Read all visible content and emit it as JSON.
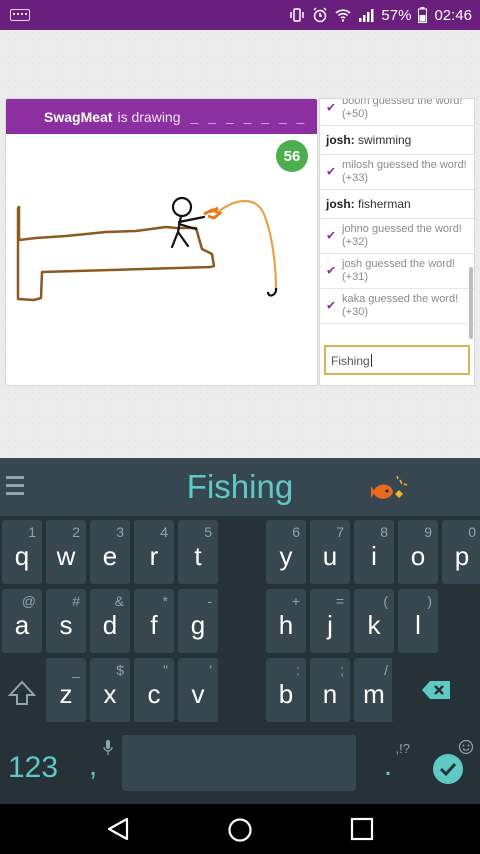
{
  "status_bar": {
    "battery": "57%",
    "time": "02:46"
  },
  "game": {
    "drawer_name": "SwagMeat",
    "drawing_text": "is drawing",
    "word_blanks": "_ _ _ _ _ _ _",
    "timer": "56"
  },
  "chat": {
    "messages": [
      {
        "type": "sys",
        "text": "boom guessed the word!",
        "points": "(+50)"
      },
      {
        "type": "chat",
        "user": "josh:",
        "text": "swimming"
      },
      {
        "type": "sys",
        "text": "milosh guessed the word!",
        "points": "(+33)"
      },
      {
        "type": "chat",
        "user": "josh:",
        "text": "fisherman"
      },
      {
        "type": "sys",
        "text": "johno guessed the word!",
        "points": "(+32)"
      },
      {
        "type": "sys",
        "text": "josh guessed the word!",
        "points": "(+31)"
      },
      {
        "type": "sys",
        "text": "kaka guessed the word!",
        "points": "(+30)"
      }
    ],
    "input_value": "Fishing"
  },
  "keyboard": {
    "suggestion": "Fishing",
    "row1": [
      {
        "ch": "q",
        "hint": "1"
      },
      {
        "ch": "w",
        "hint": "2"
      },
      {
        "ch": "e",
        "hint": "3"
      },
      {
        "ch": "r",
        "hint": "4"
      },
      {
        "ch": "t",
        "hint": "5"
      },
      {
        "ch": "y",
        "hint": "6"
      },
      {
        "ch": "u",
        "hint": "7"
      },
      {
        "ch": "i",
        "hint": "8"
      },
      {
        "ch": "o",
        "hint": "9"
      },
      {
        "ch": "p",
        "hint": "0"
      }
    ],
    "row2": [
      {
        "ch": "a",
        "hint": "@"
      },
      {
        "ch": "s",
        "hint": "#"
      },
      {
        "ch": "d",
        "hint": "&"
      },
      {
        "ch": "f",
        "hint": "*"
      },
      {
        "ch": "g",
        "hint": "-"
      },
      {
        "ch": "h",
        "hint": "+"
      },
      {
        "ch": "j",
        "hint": "="
      },
      {
        "ch": "k",
        "hint": "("
      },
      {
        "ch": "l",
        "hint": ")"
      }
    ],
    "row3": [
      {
        "ch": "z",
        "hint": "_"
      },
      {
        "ch": "x",
        "hint": "$"
      },
      {
        "ch": "c",
        "hint": "\""
      },
      {
        "ch": "v",
        "hint": "'"
      },
      {
        "ch": "b",
        "hint": ":"
      },
      {
        "ch": "n",
        "hint": ";"
      },
      {
        "ch": "m",
        "hint": "/"
      }
    ],
    "num_label": "123",
    "comma": ",",
    "period": ".",
    "punct_hint": ",!?"
  },
  "colors": {
    "status_bar": "#6b1f7c",
    "header": "#8c2fa0",
    "timer": "#4cae4c",
    "accent": "#5fc9c5"
  }
}
